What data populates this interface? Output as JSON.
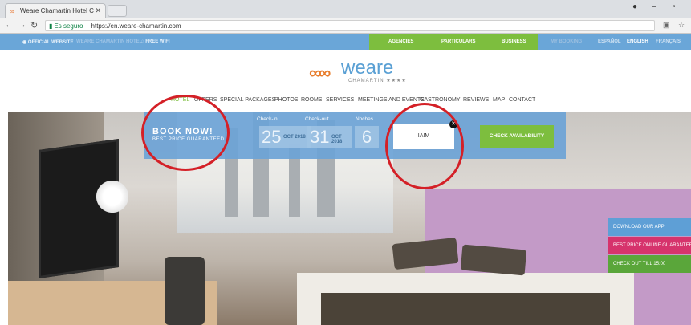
{
  "browser": {
    "tab_title": "Weare Chamartín Hotel C",
    "url_secure_label": "Es seguro",
    "url": "https://en.weare-chamartin.com"
  },
  "topbar": {
    "official": "OFFICIAL WEBSITE",
    "hotel": "WEARE CHAMARTIN HOTEL",
    "wifi": "FREE WIFI",
    "agencies": "AGENCIES",
    "particulars": "PARTICULARS",
    "business": "BUSINESS",
    "my_booking": "MY BOOKING",
    "lang_es": "ESPAÑOL",
    "lang_en": "ENGLISH",
    "lang_fr": "FRANÇAIS"
  },
  "logo": {
    "name": "weare",
    "sub": "CHAMARTIN ★★★★"
  },
  "menu": {
    "items": [
      "HOTEL",
      "OFFERS",
      "SPECIAL PACKAGES",
      "PHOTOS",
      "ROOMS",
      "SERVICES",
      "MEETINGS AND EVENTS",
      "GASTRONOMY",
      "REVIEWS",
      "MAP",
      "CONTACT"
    ]
  },
  "booking": {
    "title": "BOOK NOW!",
    "subtitle": "BEST PRICE GUARANTEED",
    "checkin_label": "Check-in",
    "checkin_day": "25",
    "checkin_month": "OCT 2018",
    "checkout_label": "Check-out",
    "checkout_day": "31",
    "checkout_month": "OCT 2018",
    "nights_label": "Noches",
    "nights_value": "6",
    "promo_code": "IAIM",
    "check_button": "CHECK AVAILABILITY"
  },
  "side_tabs": {
    "app": "DOWNLOAD OUR APP",
    "best_price": "BEST PRICE ONLINE GUARANTEED",
    "checkout": "CHECK OUT TILL 15:00"
  },
  "colors": {
    "accent_blue": "#6aa6d8",
    "accent_green": "#7dbe3e",
    "annotation_red": "#d42027",
    "promo_pink": "#d6336c"
  }
}
